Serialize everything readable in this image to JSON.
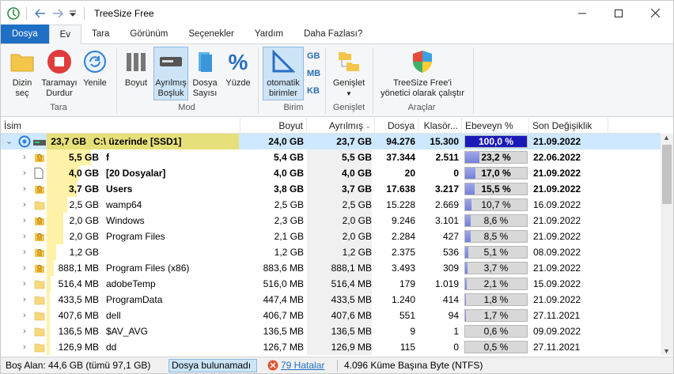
{
  "window": {
    "title": "TreeSize Free"
  },
  "tabs": [
    {
      "label": "Dosya"
    },
    {
      "label": "Ev"
    },
    {
      "label": "Tara"
    },
    {
      "label": "Görünüm"
    },
    {
      "label": "Seçenekler"
    },
    {
      "label": "Yardım"
    },
    {
      "label": "Daha Fazlası?"
    }
  ],
  "ribbon": {
    "scan_dir": "Dizin\nseç",
    "stop_scan": "Taramayı\nDurdur",
    "refresh": "Yenile",
    "group_scan": "Tara",
    "size": "Boyut",
    "allocated": "Ayrılmış\nBoşluk",
    "file_count": "Dosya\nSayısı",
    "percent": "Yüzde",
    "group_mode": "Mod",
    "auto_units": "otomatik\nbirimler",
    "unit_gb": "GB",
    "unit_mb": "MB",
    "unit_kb": "KB",
    "group_units": "Birim",
    "expand": "Genişlet",
    "group_expand": "Genişlet",
    "run_admin": "TreeSize Free'i\nyönetici olarak çalıştır",
    "group_tools": "Araçlar"
  },
  "columns": {
    "name": "İsim",
    "size": "Boyut",
    "allocated": "Ayrılmış",
    "files": "Dosya",
    "folders": "Klasör...",
    "parent_pct": "Ebeveyn % (...",
    "modified": "Son Değişiklik"
  },
  "root": {
    "size_label": "23,7 GB",
    "name": "C:\\  üzerinde  [SSD1]",
    "size": "24,0 GB",
    "allocated": "23,7 GB",
    "files": "94.276",
    "folders": "15.300",
    "pct": 100.0,
    "pct_label": "100,0 %",
    "modified": "21.09.2022"
  },
  "rows": [
    {
      "size_label": "5,5 GB",
      "name": "f",
      "size": "5,4 GB",
      "allocated": "5,5 GB",
      "files": "37.344",
      "folders": "2.511",
      "pct": 23.2,
      "pct_label": "23,2 %",
      "modified": "22.06.2022",
      "bold": true,
      "icon": "locked-folder"
    },
    {
      "size_label": "4,0 GB",
      "name": "[20 Dosyalar]",
      "size": "4,0 GB",
      "allocated": "4,0 GB",
      "files": "20",
      "folders": "0",
      "pct": 17.0,
      "pct_label": "17,0 %",
      "modified": "21.09.2022",
      "bold": true,
      "icon": "file"
    },
    {
      "size_label": "3,7 GB",
      "name": "Users",
      "size": "3,8 GB",
      "allocated": "3,7 GB",
      "files": "17.638",
      "folders": "3.217",
      "pct": 15.5,
      "pct_label": "15,5 %",
      "modified": "21.09.2022",
      "bold": true,
      "icon": "locked-folder"
    },
    {
      "size_label": "2,5 GB",
      "name": "wamp64",
      "size": "2,5 GB",
      "allocated": "2,5 GB",
      "files": "15.228",
      "folders": "2.669",
      "pct": 10.7,
      "pct_label": "10,7 %",
      "modified": "16.09.2022",
      "bold": false,
      "icon": "folder"
    },
    {
      "size_label": "2,0 GB",
      "name": "Windows",
      "size": "2,3 GB",
      "allocated": "2,0 GB",
      "files": "9.246",
      "folders": "3.101",
      "pct": 8.6,
      "pct_label": "8,6 %",
      "modified": "21.09.2022",
      "bold": false,
      "icon": "locked-folder"
    },
    {
      "size_label": "2,0 GB",
      "name": "Program Files",
      "size": "2,1 GB",
      "allocated": "2,0 GB",
      "files": "2.284",
      "folders": "427",
      "pct": 8.5,
      "pct_label": "8,5 %",
      "modified": "21.09.2022",
      "bold": false,
      "icon": "locked-folder"
    },
    {
      "size_label": "1,2 GB",
      "name": "",
      "size": "1,2 GB",
      "allocated": "1,2 GB",
      "files": "2.375",
      "folders": "536",
      "pct": 5.1,
      "pct_label": "5,1 %",
      "modified": "08.09.2022",
      "bold": false,
      "icon": "locked-folder"
    },
    {
      "size_label": "888,1 MB",
      "name": "Program Files (x86)",
      "size": "883,6 MB",
      "allocated": "888,1 MB",
      "files": "3.493",
      "folders": "309",
      "pct": 3.7,
      "pct_label": "3,7 %",
      "modified": "21.09.2022",
      "bold": false,
      "icon": "locked-folder"
    },
    {
      "size_label": "516,4 MB",
      "name": "adobeTemp",
      "size": "516,0 MB",
      "allocated": "516,4 MB",
      "files": "179",
      "folders": "1.019",
      "pct": 2.1,
      "pct_label": "2,1 %",
      "modified": "15.09.2022",
      "bold": false,
      "icon": "folder"
    },
    {
      "size_label": "433,5 MB",
      "name": "ProgramData",
      "size": "447,4 MB",
      "allocated": "433,5 MB",
      "files": "1.240",
      "folders": "414",
      "pct": 1.8,
      "pct_label": "1,8 %",
      "modified": "21.09.2022",
      "bold": false,
      "icon": "folder"
    },
    {
      "size_label": "407,6 MB",
      "name": "dell",
      "size": "406,7 MB",
      "allocated": "407,6 MB",
      "files": "551",
      "folders": "94",
      "pct": 1.7,
      "pct_label": "1,7 %",
      "modified": "27.11.2021",
      "bold": false,
      "icon": "folder"
    },
    {
      "size_label": "136,5 MB",
      "name": "$AV_AVG",
      "size": "136,5 MB",
      "allocated": "136,5 MB",
      "files": "9",
      "folders": "1",
      "pct": 0.6,
      "pct_label": "0,6 %",
      "modified": "09.09.2022",
      "bold": false,
      "icon": "folder"
    },
    {
      "size_label": "126,9 MB",
      "name": "dd",
      "size": "126,7 MB",
      "allocated": "126,9 MB",
      "files": "115",
      "folders": "0",
      "pct": 0.5,
      "pct_label": "0,5 %",
      "modified": "27.11.2021",
      "bold": false,
      "icon": "folder"
    }
  ],
  "status": {
    "free_space": "Boş Alan: 44,6 GB  (tümü 97,1 GB)",
    "search": "Dosya bulunamadı",
    "errors": "79 Hatalar",
    "cluster": "4.096 Küme Başına Byte (NTFS)"
  },
  "colors": {
    "accent": "#1f6fc4",
    "selection": "#cde8ff",
    "bar_fill": "#7680d9",
    "size_shade": "#fff1a8"
  }
}
